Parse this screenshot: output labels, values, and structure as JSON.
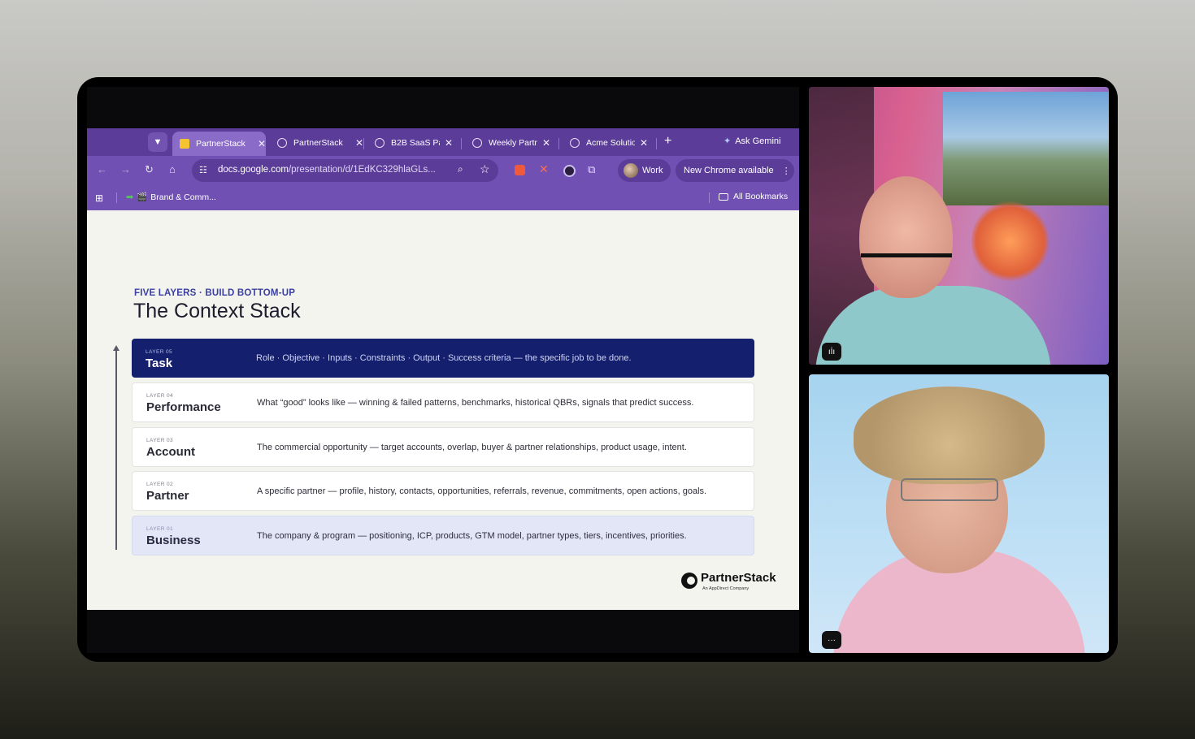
{
  "browser": {
    "tabs": [
      {
        "title": "PartnerStack",
        "active": true
      },
      {
        "title": "PartnerStack",
        "active": false
      },
      {
        "title": "B2B SaaS Pa",
        "active": false
      },
      {
        "title": "Weekly Partn",
        "active": false
      },
      {
        "title": "Acme Solutio",
        "active": false
      }
    ],
    "ask_gemini": "Ask Gemini",
    "url_host": "docs.google.com",
    "url_path": "/presentation/d/1EdKC329hlaGLs...",
    "profile_label": "Work",
    "update_label": "New Chrome available",
    "bookmark_label": "Brand & Comm...",
    "all_bookmarks": "All Bookmarks"
  },
  "slide": {
    "eyebrow": "FIVE LAYERS · BUILD BOTTOM-UP",
    "title": "The Context Stack",
    "layers": [
      {
        "num": "LAYER 05",
        "name": "Task",
        "desc": "Role · Objective · Inputs · Constraints · Output · Success criteria — the specific job to be done."
      },
      {
        "num": "LAYER 04",
        "name": "Performance",
        "desc": "What “good” looks like — winning & failed patterns, benchmarks, historical QBRs, signals that predict success."
      },
      {
        "num": "LAYER 03",
        "name": "Account",
        "desc": "The commercial opportunity — target accounts, overlap, buyer & partner relationships, product usage, intent."
      },
      {
        "num": "LAYER 02",
        "name": "Partner",
        "desc": "A specific partner — profile, history, contacts, opportunities, referrals, revenue, commitments, open actions, goals."
      },
      {
        "num": "LAYER 01",
        "name": "Business",
        "desc": "The company & program — positioning, ICP, products, GTM model, partner types, tiers, incentives, priorities."
      }
    ],
    "logo_wordmark": "PartnerStack",
    "logo_tagline": "An AppDirect Company"
  },
  "colors": {
    "tab_strip": "#5b3c98",
    "toolbar": "#7050b3",
    "task_layer": "#141f6e",
    "eyebrow": "#3a3fa0"
  }
}
